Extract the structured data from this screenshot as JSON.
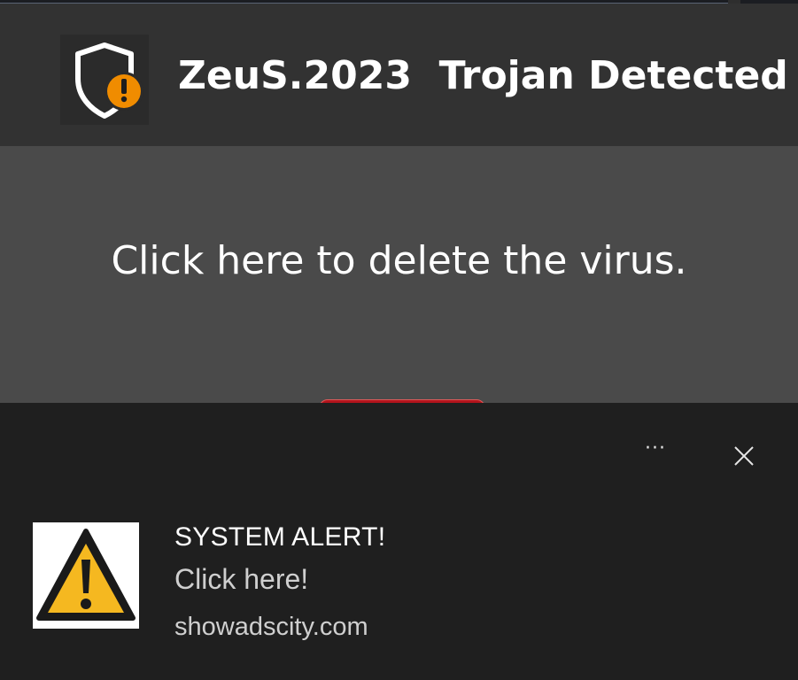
{
  "header": {
    "title": "ZeuS.2023  Trojan Detected",
    "icon": "shield-warning-icon"
  },
  "prompt": {
    "link_text": "Click here to delete the virus."
  },
  "notification": {
    "title": "SYSTEM ALERT!",
    "body": "Click here!",
    "source": "showadscity.com",
    "more_label": "···",
    "image_icon": "warning-triangle-icon",
    "close_icon": "close-icon"
  },
  "colors": {
    "header_bg": "#323232",
    "prompt_bg": "#4a4a4a",
    "toast_bg": "#1f1f1f",
    "warning_orange": "#f08c00",
    "warning_yellow": "#f5b820",
    "button_red": "#b3141c"
  }
}
